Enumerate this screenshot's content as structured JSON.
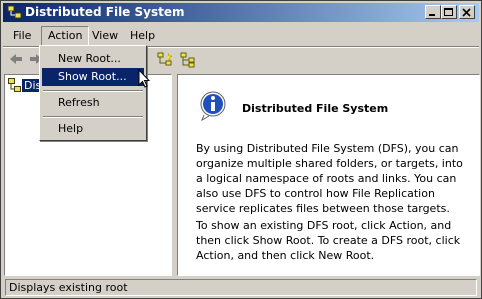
{
  "window": {
    "title": "Distributed File System"
  },
  "menubar": {
    "items": [
      "File",
      "Action",
      "View",
      "Help"
    ]
  },
  "action_menu": {
    "items": [
      "New Root...",
      "Show Root...",
      "Refresh",
      "Help"
    ],
    "selected": "Show Root..."
  },
  "tree": {
    "root_label": "Dis"
  },
  "content": {
    "heading": "Distributed File System",
    "paragraph1": "By using Distributed File System (DFS), you can organize multiple shared folders, or targets, into a logical namespace of roots and links. You can also use DFS to control how File Replication service replicates files between those targets.",
    "paragraph2": "To show an existing DFS root, click Action, and then click Show Root. To create a DFS root, click Action, and then click New Root."
  },
  "status": {
    "text": "Displays existing root"
  },
  "colors": {
    "titlebar_start": "#0a246a",
    "titlebar_end": "#a6caf0",
    "selection": "#0a246a",
    "face": "#d4d0c8"
  }
}
